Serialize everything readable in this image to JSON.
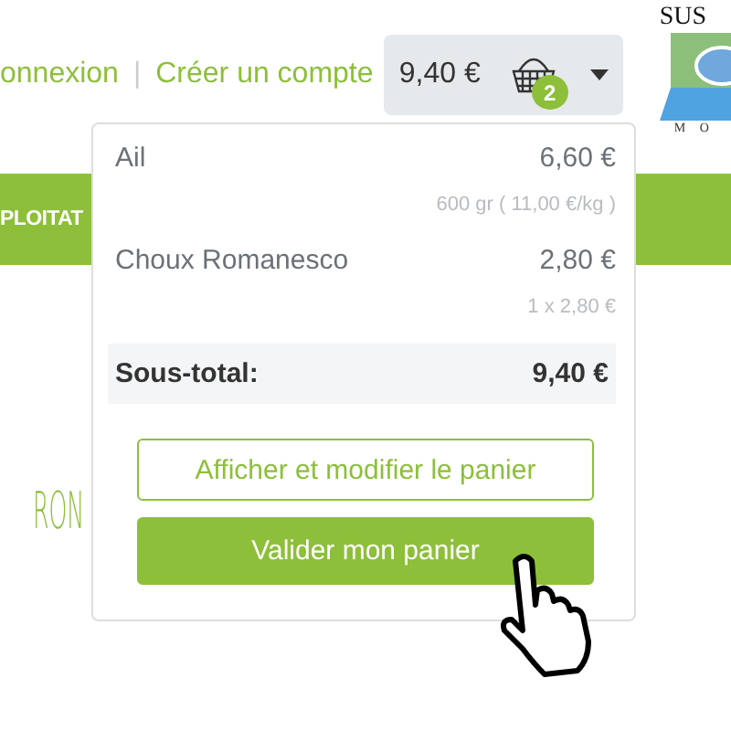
{
  "header": {
    "links": [
      {
        "label": "onnexion"
      },
      {
        "label": "Créer un compte"
      }
    ],
    "separator": "|"
  },
  "cart": {
    "total": "9,40 €",
    "count": "2",
    "expanded": true
  },
  "logo": {
    "top": "SUS",
    "bottom": "M O"
  },
  "banner": {
    "label": "PLOITAT"
  },
  "heading_fragment": "RON",
  "dropdown": {
    "items": [
      {
        "name": "Ail",
        "price": "6,60 €",
        "detail": "600 gr ( 11,00 €/kg )"
      },
      {
        "name": "Choux Romanesco",
        "price": "2,80 €",
        "detail": "1 x 2,80 €"
      }
    ],
    "subtotal": {
      "label": "Sous-total:",
      "value": "9,40 €"
    },
    "buttons": [
      {
        "label": "Afficher et modifier le panier",
        "kind": "outline"
      },
      {
        "label": "Valider mon panier",
        "kind": "primary"
      }
    ]
  }
}
